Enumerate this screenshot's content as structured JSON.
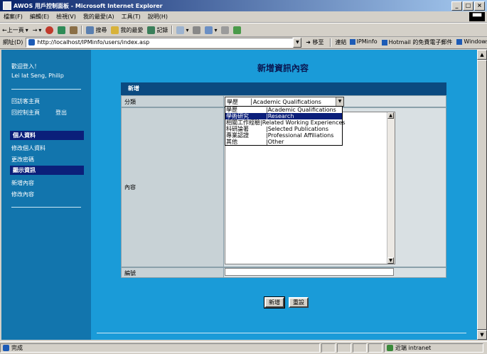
{
  "window": {
    "title": "AWOS 用戶控制面板 - Microsoft Internet Explorer",
    "buttons": {
      "minimize": "_",
      "maximize": "□",
      "close": "×"
    },
    "logo": "▀▀"
  },
  "menubar": [
    "檔案(F)",
    "編輯(E)",
    "檢視(V)",
    "我的最愛(A)",
    "工具(T)",
    "說明(H)"
  ],
  "toolbar": {
    "back": "←上一頁",
    "forward": "→",
    "search": "搜尋",
    "favorites": "我的最愛",
    "history": "記錄"
  },
  "address": {
    "label": "網址(D)",
    "url": "http://localhost/IPMinfo/users/index.asp",
    "go": "移至",
    "links_label": "連結",
    "links": [
      "IPMinfo",
      "Hotmail 的免費電子郵件",
      "Windows"
    ]
  },
  "sidebar": {
    "welcome": "歡迎登入！",
    "user": "Lei Iat Seng, Philip",
    "visitor_home": "回訪客主頁",
    "control_home": "回控制主頁",
    "logout": "登出",
    "section_personal": "個人資料",
    "edit_profile": "修改個人資料",
    "change_password": "更改密碼",
    "section_display": "顯示資訊",
    "add_content": "新增內容",
    "edit_content": "修改內容"
  },
  "main": {
    "page_title": "新增資訊內容",
    "form_header": "新增",
    "category_label": "分類",
    "content_label": "內容",
    "order_label": "編號",
    "selected_category": "學歷　　│Academic Qualifications",
    "options": [
      {
        "zh": "學歷",
        "en": "|Academic Qualifications"
      },
      {
        "zh": "學術研究",
        "en": "|Research"
      },
      {
        "zh": "相關工作經驗",
        "en": "|Related Working Experiences"
      },
      {
        "zh": "科研論著",
        "en": "|Selected Publications"
      },
      {
        "zh": "專業認證",
        "en": "|Professional Affiliations"
      },
      {
        "zh": "其他",
        "en": "|Other"
      }
    ],
    "selected_index": 1,
    "add_button": "新增",
    "reset_button": "重設"
  },
  "status": {
    "left": "完成",
    "zone": "近端 intranet"
  },
  "colors": {
    "page_bg": "#1a9bd8",
    "sidebar_bg": "#1275ad",
    "nav_section_bg": "#0b1f7a",
    "form_header_bg": "#0b4a80",
    "title_color": "#0a1650"
  }
}
